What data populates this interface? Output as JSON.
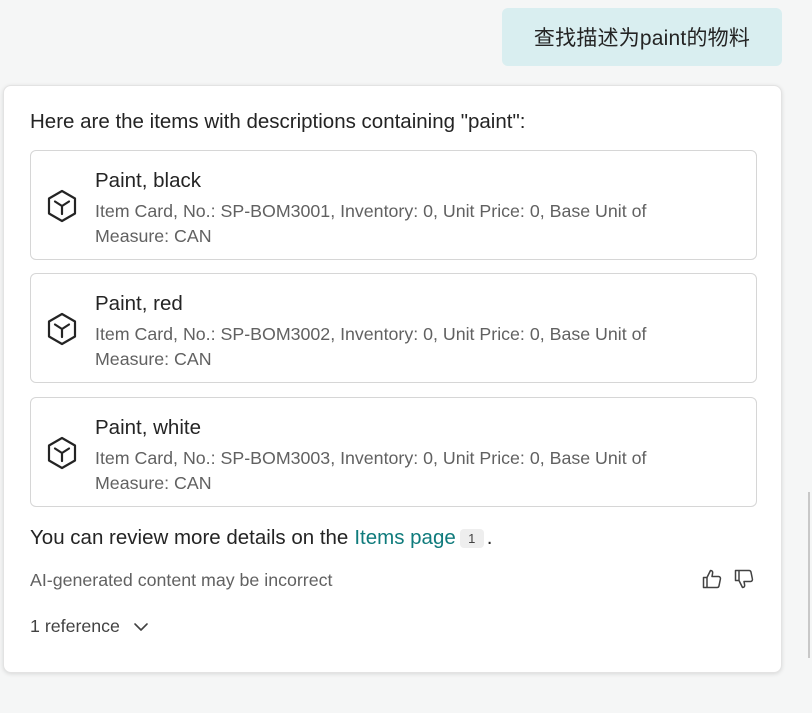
{
  "user_message": "查找描述为paint的物料",
  "response": {
    "intro": "Here are the items with descriptions containing \"paint\":",
    "items": [
      {
        "title": "Paint, black",
        "description": "Item Card, No.: SP-BOM3001, Inventory: 0, Unit Price: 0, Base Unit of Measure: CAN",
        "icon": "box-icon"
      },
      {
        "title": "Paint, red",
        "description": "Item Card, No.: SP-BOM3002, Inventory: 0, Unit Price: 0, Base Unit of Measure: CAN",
        "icon": "box-icon"
      },
      {
        "title": "Paint, white",
        "description": "Item Card, No.: SP-BOM3003, Inventory: 0, Unit Price: 0, Base Unit of Measure: CAN",
        "icon": "box-icon"
      }
    ],
    "more_text": "You can review more details on the",
    "link_text": "Items page",
    "citation_number": "1",
    "period": ".",
    "disclaimer": "AI-generated content may be incorrect",
    "references_label": "1 reference",
    "feedback_icons": [
      "thumbs-up-icon",
      "thumbs-down-icon"
    ]
  },
  "colors": {
    "user_bubble": "#d9eef0",
    "link": "#0f7b7c",
    "page_background": "#f5f6f6"
  }
}
